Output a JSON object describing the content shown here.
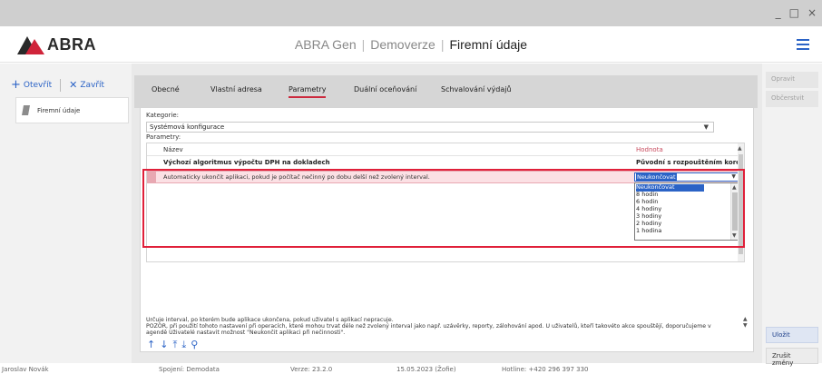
{
  "window": {
    "minimize": "_",
    "maximize": "□",
    "close": "×"
  },
  "header": {
    "logo": "ABRA",
    "app_name": "ABRA Gen",
    "edition": "Demoverze",
    "page_title": "Firemní údaje",
    "menu_icon": "hamburger-icon",
    "accent_color": "#2b63c6"
  },
  "left_panel": {
    "open_label": "Otevřít",
    "close_label": "Zavřít",
    "document_item": "Firemní údaje"
  },
  "tabs": [
    {
      "label": "Obecné",
      "active": false
    },
    {
      "label": "Vlastní adresa",
      "active": false
    },
    {
      "label": "Parametry",
      "active": true
    },
    {
      "label": "Duální oceňování",
      "active": false
    },
    {
      "label": "Schvalování výdajů",
      "active": false
    }
  ],
  "form": {
    "category_label": "Kategorie:",
    "category_value": "Systémová konfigurace",
    "parameters_label": "Parametry:",
    "columns": {
      "name": "Název",
      "value": "Hodnota"
    },
    "group_row": {
      "name": "Výchozí algoritmus výpočtu DPH na dokladech",
      "value": "Původní s rozpouštěním korekcí"
    },
    "selected_row": {
      "name": "Automaticky ukončit aplikaci, pokud je počítač nečinný po dobu delší než zvolený interval.",
      "value": "Neukončovat"
    },
    "dropdown_options": [
      "Neukončovat",
      "8 hodin",
      "6 hodin",
      "4 hodiny",
      "3 hodiny",
      "2 hodiny",
      "1 hodina"
    ],
    "description_lines": [
      "Určuje interval, po kterém bude aplikace ukončena, pokud uživatel s aplikací nepracuje.",
      "POZOR, při použití tohoto nastavení při operacích, které mohou trvat déle než zvolený interval jako např. uzávěrky, reporty, zálohování apod. U uživatelů, kteří takovéto akce spouštějí, doporučujeme v",
      "agendě Uživatelé nastavit možnost \"Neukončit aplikaci při nečinnosti\"."
    ],
    "highlight_color": "#e0203a"
  },
  "right_panel": {
    "edit": "Opravit",
    "refresh": "Občerstvit",
    "save": "Uložit",
    "cancel": "Zrušit změny"
  },
  "statusbar": {
    "user": "Jaroslav Novák",
    "connection": "Spojení: Demodata",
    "version": "Verze: 23.2.0",
    "date": "15.05.2023 (Žofie)",
    "hotline": "Hotline: +420 296 397 330"
  }
}
